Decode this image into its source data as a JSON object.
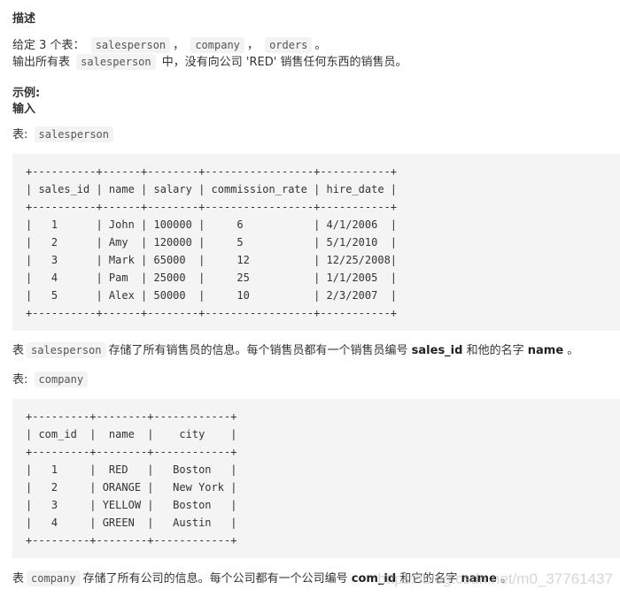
{
  "section_title": "描述",
  "intro": {
    "given_prefix": "给定 3 个表：",
    "tables": [
      "salesperson",
      "company",
      "orders"
    ],
    "sep": "，",
    "end": "。",
    "task_prefix": "输出所有表",
    "task_table": "salesperson",
    "task_suffix": "中，没有向公司 'RED' 销售任何东西的销售员。"
  },
  "example_label": "示例:",
  "input_label": "输入",
  "salesperson_table": {
    "label_prefix": "表:",
    "name": "salesperson",
    "text": "+----------+------+--------+-----------------+-----------+\n| sales_id | name | salary | commission_rate | hire_date |\n+----------+------+--------+-----------------+-----------+\n|   1      | John | 100000 |     6           | 4/1/2006  |\n|   2      | Amy  | 120000 |     5           | 5/1/2010  |\n|   3      | Mark | 65000  |     12          | 12/25/2008|\n|   4      | Pam  | 25000  |     25          | 1/1/2005  |\n|   5      | Alex | 50000  |     10          | 2/3/2007  |\n+----------+------+--------+-----------------+-----------+",
    "columns": [
      "sales_id",
      "name",
      "salary",
      "commission_rate",
      "hire_date"
    ],
    "rows": [
      [
        "1",
        "John",
        "100000",
        "6",
        "4/1/2006"
      ],
      [
        "2",
        "Amy",
        "120000",
        "5",
        "5/1/2010"
      ],
      [
        "3",
        "Mark",
        "65000",
        "12",
        "12/25/2008"
      ],
      [
        "4",
        "Pam",
        "25000",
        "25",
        "1/1/2005"
      ],
      [
        "5",
        "Alex",
        "50000",
        "10",
        "2/3/2007"
      ]
    ],
    "desc_prefix": "表",
    "desc_middle": "存储了所有销售员的信息。每个销售员都有一个销售员编号",
    "desc_key": "sales_id",
    "desc_and": "和他的名字",
    "desc_name": "name",
    "desc_end": "。"
  },
  "company_table": {
    "label_prefix": "表:",
    "name": "company",
    "text": "+---------+--------+------------+\n| com_id  |  name  |    city    |\n+---------+--------+------------+\n|   1     |  RED   |   Boston   |\n|   2     | ORANGE |   New York |\n|   3     | YELLOW |   Boston   |\n|   4     | GREEN  |   Austin   |\n+---------+--------+------------+",
    "columns": [
      "com_id",
      "name",
      "city"
    ],
    "rows": [
      [
        "1",
        "RED",
        "Boston"
      ],
      [
        "2",
        "ORANGE",
        "New York"
      ],
      [
        "3",
        "YELLOW",
        "Boston"
      ],
      [
        "4",
        "GREEN",
        "Austin"
      ]
    ],
    "desc_prefix": "表",
    "desc_middle": "存储了所有公司的信息。每个公司都有一个公司编号",
    "desc_key": "com_id",
    "desc_and": "和它的名字",
    "desc_name": "name",
    "desc_end": "。"
  },
  "watermark": "https://blog.csdn.net/m0_37761437"
}
